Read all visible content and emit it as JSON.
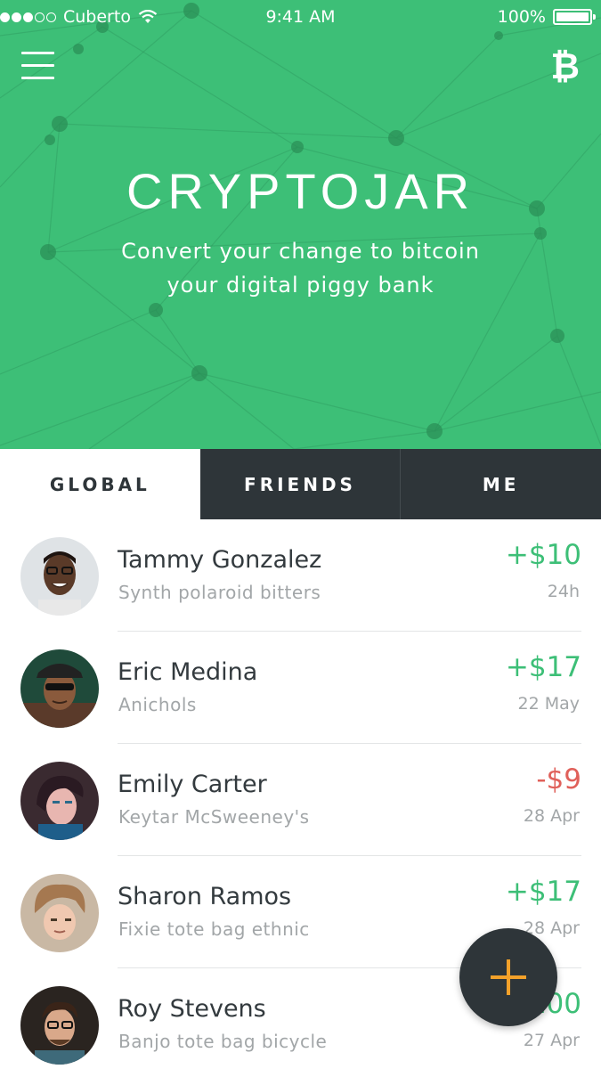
{
  "status_bar": {
    "carrier": "Cuberto",
    "time": "9:41 AM",
    "battery": "100%",
    "signal_bars_filled": 3,
    "signal_bars_total": 5
  },
  "header": {
    "menu_icon": "menu-icon",
    "right_icon": "bitcoin-icon",
    "bitcoin_symbol": "₿",
    "title": "CRYPTOJAR",
    "subtitle_line1": "Convert your change to bitcoin",
    "subtitle_line2": "your digital piggy bank",
    "background_color": "#3dbf77"
  },
  "tabs": [
    {
      "label": "GLOBAL",
      "active": true
    },
    {
      "label": "FRIENDS",
      "active": false
    },
    {
      "label": "ME",
      "active": false
    }
  ],
  "transactions": [
    {
      "name": "Tammy Gonzalez",
      "description": "Synth polaroid bitters",
      "amount": "+$10",
      "date": "24h",
      "sign": "positive"
    },
    {
      "name": "Eric Medina",
      "description": "Anichols",
      "amount": "+$17",
      "date": "22 May",
      "sign": "positive"
    },
    {
      "name": "Emily Carter",
      "description": "Keytar McSweeney's",
      "amount": "-$9",
      "date": "28 Apr",
      "sign": "negative"
    },
    {
      "name": "Sharon Ramos",
      "description": "Fixie tote bag ethnic",
      "amount": "+$17",
      "date": "28 Apr",
      "sign": "positive"
    },
    {
      "name": "Roy Stevens",
      "description": "Banjo tote bag bicycle",
      "amount": "+$100",
      "date": "27 Apr",
      "sign": "positive"
    }
  ],
  "fab": {
    "icon": "plus-icon",
    "color": "#f3a12a",
    "background": "#2e3539"
  },
  "colors": {
    "positive": "#3dbf77",
    "negative": "#e0605a",
    "dark": "#2e3539"
  }
}
